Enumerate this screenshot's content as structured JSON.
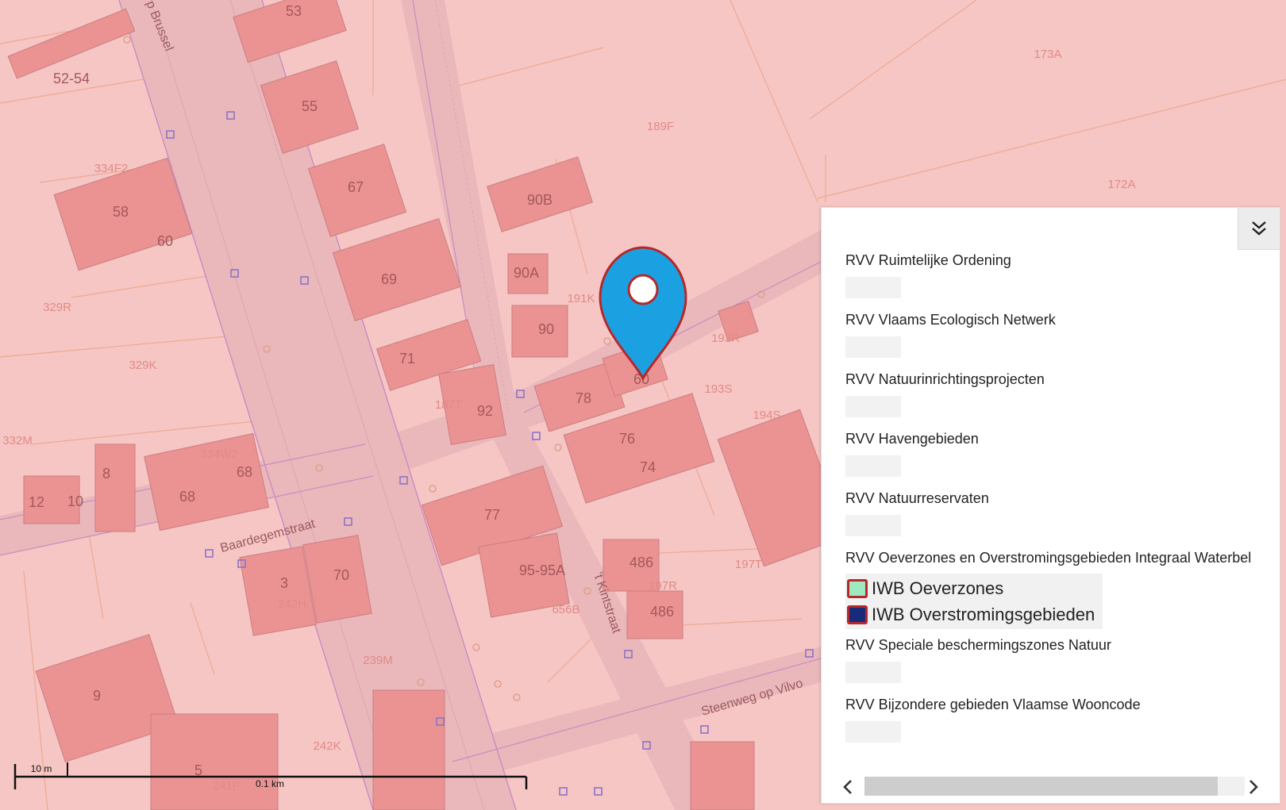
{
  "map": {
    "house_numbers": [
      "53",
      "52-54",
      "55",
      "67",
      "58",
      "60",
      "69",
      "90B",
      "90A",
      "90",
      "71",
      "92",
      "78",
      "60",
      "76",
      "74",
      "8",
      "12",
      "10",
      "68",
      "68",
      "77",
      "95-95A",
      "486",
      "486",
      "3",
      "70",
      "9",
      "5"
    ],
    "parcel_ids": [
      "173A",
      "189F",
      "172A",
      "334F2",
      "329R",
      "329K",
      "191K",
      "193R",
      "193S",
      "187T",
      "194S",
      "332M",
      "334W2",
      "197T",
      "197R",
      "656B",
      "242H",
      "239M",
      "242K",
      "241F"
    ],
    "street_names": {
      "steenweg_brussel": "p Brussel",
      "baardegemstraat": "Baardegemstraat",
      "kintstraat": "'t Kintstraat",
      "steenweg_vilvo": "Steenweg op Vilvo"
    },
    "marker": {
      "color": "#1ba1e2",
      "outline": "#b5282a",
      "icon": "map-pin-icon"
    }
  },
  "scale": {
    "small_label": "10 m",
    "large_label": "0.1 km"
  },
  "legend": {
    "toggle_icon": "double-chevron-down-icon",
    "layers": [
      {
        "title": "RVV Ruimtelijke Ordening"
      },
      {
        "title": "RVV Vlaams Ecologisch Netwerk"
      },
      {
        "title": "RVV Natuurinrichtingsprojecten"
      },
      {
        "title": "RVV Havengebieden"
      },
      {
        "title": "RVV Natuurreservaten"
      },
      {
        "title": "RVV Oeverzones en Overstromingsgebieden Integraal Waterbel"
      },
      {
        "title": "RVV Speciale beschermingszones Natuur"
      },
      {
        "title": "RVV Bijzondere gebieden Vlaamse Wooncode"
      }
    ],
    "iwb_items": [
      {
        "label": "IWB Oeverzones",
        "color": "#9ee8c2"
      },
      {
        "label": "IWB Overstromingsgebieden",
        "color": "#1a2a7a"
      }
    ],
    "scroll_left_icon": "chevron-left-icon",
    "scroll_right_icon": "chevron-right-icon"
  }
}
